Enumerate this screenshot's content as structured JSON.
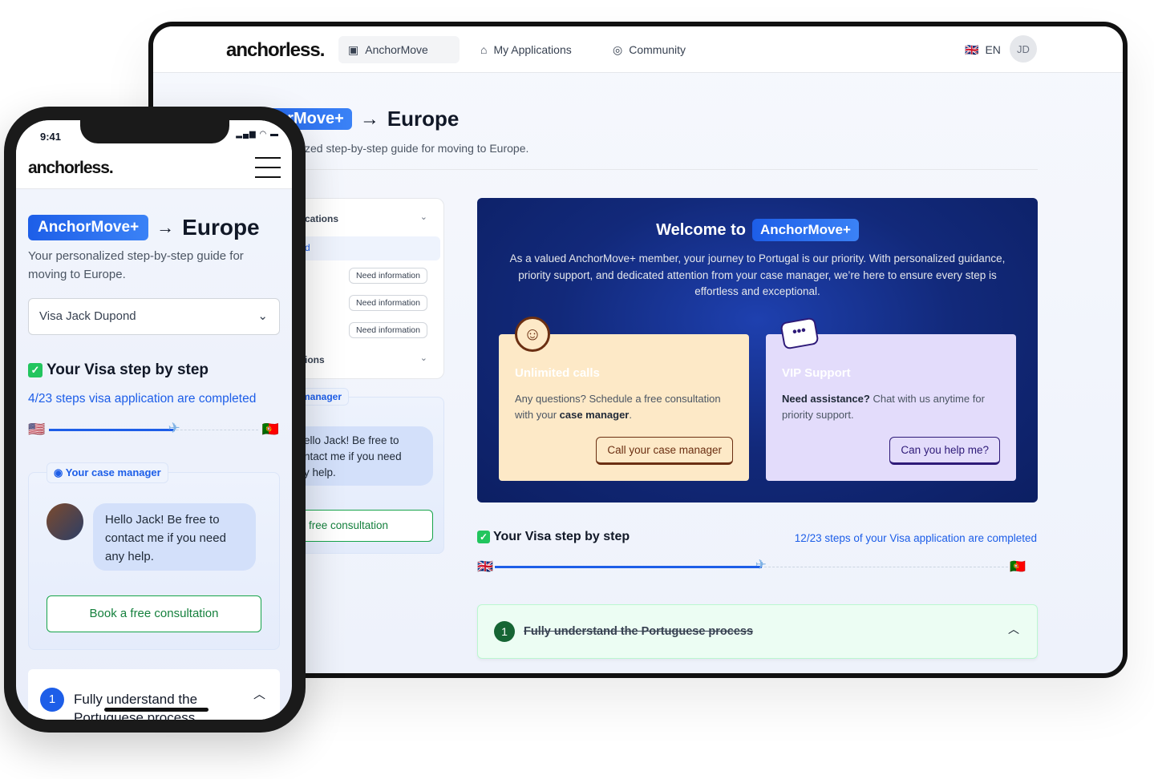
{
  "desktop": {
    "nav": {
      "logo": "anchorless.",
      "items": [
        {
          "label": "AnchorMove",
          "icon": "passport-icon"
        },
        {
          "label": "My Applications",
          "icon": "home-icon"
        },
        {
          "label": "Community",
          "icon": "globe-icon"
        }
      ],
      "lang": "EN",
      "avatar": "JD"
    },
    "hero": {
      "badge": "AnchorMove+",
      "arrow": "→",
      "title": "Europe",
      "subtitle": "Your personalized step-by-step guide for moving to Europe."
    },
    "left": {
      "section1": "cations",
      "active": "d",
      "need": [
        "Need information",
        "Need information",
        "Need information"
      ],
      "section2": "ions",
      "manager_tab": "e manager",
      "message": "ello Jack! Be free to\nntact me if you need\ny help.",
      "consult": "free consultation"
    },
    "welcome": {
      "title": "Welcome to",
      "badge": "AnchorMove+",
      "text": "As a valued AnchorMove+ member, your journey to Portugal is our priority. With personalized guidance, priority support, and dedicated attention from your case manager, we’re here to ensure every step is effortless and exceptional.",
      "calls": {
        "title": "Unlimited calls",
        "text1": "Any questions? Schedule a free consultation with your ",
        "bold": "case manager",
        "text2": ".",
        "button": "Call your case manager"
      },
      "vip": {
        "title": "VIP Support",
        "bold": "Need assistance?",
        "text": " Chat with us anytime for priority support.",
        "button": "Can you help me?"
      }
    },
    "steps": {
      "title": "Your Visa step by step",
      "progress_text": "12/23 steps of your Visa application are completed",
      "progress": 0.52,
      "from": "🇬🇧",
      "to": "🇵🇹",
      "step_num": "1",
      "step_title": "Fully understand the Portuguese process"
    }
  },
  "phone": {
    "time": "9:41",
    "logo": "anchorless.",
    "badge": "AnchorMove+",
    "arrow": "→",
    "title": "Europe",
    "subtitle": "Your personalized step-by-step guide for moving to Europe.",
    "select": "Visa Jack Dupond",
    "steps_title": "Your Visa step by step",
    "progress_text": "4/23 steps visa application are completed",
    "progress": 0.6,
    "from": "🇺🇸",
    "to": "🇵🇹",
    "manager_tab": "Your case manager",
    "message": "Hello Jack! Be free to contact me if you need any help.",
    "consult": "Book a free consultation",
    "step_num": "1",
    "step_title": "Fully understand the Portuguese process"
  },
  "colors": {
    "brand": "#1d5ee8",
    "navy": "#12297a",
    "green": "#15803d",
    "calls_bg": "#fde9c7",
    "vip_bg": "#e3dcfb"
  }
}
